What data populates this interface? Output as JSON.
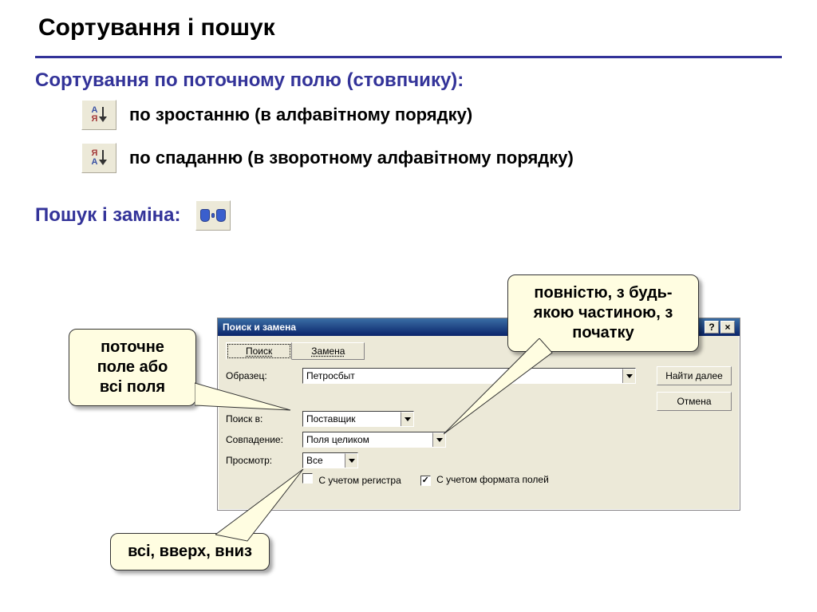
{
  "title": "Сортування і пошук",
  "section_sort": "Сортування по поточному полю (стовпчику):",
  "sort_asc": "по зростанню (в алфавітному порядку)",
  "sort_desc": "по спаданню (в зворотному алфавітному порядку)",
  "section_search": "Пошук і заміна:",
  "callouts": {
    "field": "поточне\nполе або\nвсі поля",
    "match": "повністю, з будь-\nякою частиною, з\nпочатку",
    "view": "всі, вверх, вниз"
  },
  "dialog": {
    "title": "Поиск и замена",
    "help_btn": "?",
    "close_btn": "×",
    "tab_search": "Поиск",
    "tab_replace": "Замена",
    "label_sample": "Образец:",
    "value_sample": "Петросбыт",
    "label_lookin": "Поиск в:",
    "value_lookin": "Поставщик",
    "label_match": "Совпадение:",
    "value_match": "Поля целиком",
    "label_view": "Просмотр:",
    "value_view": "Все",
    "chk_case": "С учетом регистра",
    "chk_format": "С учетом формата полей",
    "btn_next": "Найти далее",
    "btn_cancel": "Отмена"
  }
}
